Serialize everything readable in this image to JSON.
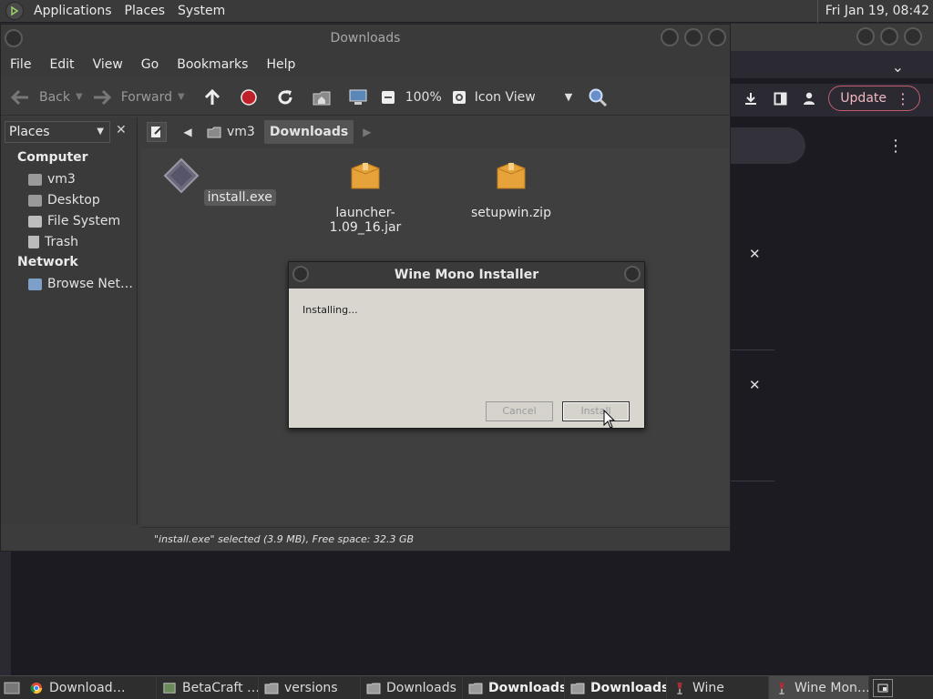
{
  "top_panel": {
    "menus": [
      "Applications",
      "Places",
      "System"
    ],
    "clock": "Fri Jan 19, 08:42"
  },
  "browser": {
    "update_label": "Update"
  },
  "file_manager": {
    "title": "Downloads",
    "menu": [
      "File",
      "Edit",
      "View",
      "Go",
      "Bookmarks",
      "Help"
    ],
    "toolbar": {
      "back": "Back",
      "forward": "Forward",
      "zoom": "100%",
      "view_mode": "Icon View"
    },
    "sidebar": {
      "header": "Places",
      "sections": [
        {
          "title": "Computer",
          "items": [
            "vm3",
            "Desktop",
            "File System",
            "Trash"
          ]
        },
        {
          "title": "Network",
          "items": [
            "Browse Net…"
          ]
        }
      ]
    },
    "pathbar": [
      "vm3",
      "Downloads"
    ],
    "files": [
      {
        "name": "install.exe",
        "selected": true,
        "icon": "exe-icon"
      },
      {
        "name": "launcher-1.09_16.jar",
        "selected": false,
        "icon": "package-icon"
      },
      {
        "name": "setupwin.zip",
        "selected": false,
        "icon": "package-icon"
      }
    ],
    "status": "\"install.exe\" selected (3.9 MB), Free space: 32.3 GB"
  },
  "wine_dialog": {
    "title": "Wine Mono Installer",
    "message": "Installing...",
    "cancel": "Cancel",
    "install": "Install"
  },
  "taskbar": {
    "tasks": [
      {
        "label": "Download…",
        "icon": "chrome-icon",
        "bold": false
      },
      {
        "label": "BetaCraft …",
        "icon": "app-icon",
        "bold": false
      },
      {
        "label": "versions",
        "icon": "folder-icon",
        "bold": false
      },
      {
        "label": "Downloads",
        "icon": "folder-icon",
        "bold": false
      },
      {
        "label": "Downloads",
        "icon": "folder-icon",
        "bold": true
      },
      {
        "label": "Downloads",
        "icon": "folder-icon",
        "bold": true
      },
      {
        "label": "Wine",
        "icon": "wine-icon",
        "bold": false
      },
      {
        "label": "Wine Mon…",
        "icon": "wine-icon",
        "bold": false
      }
    ]
  },
  "colors": {
    "update_accent": "#c35d6e",
    "record_red": "#c0202a",
    "folder_orange": "#e8a23a"
  }
}
